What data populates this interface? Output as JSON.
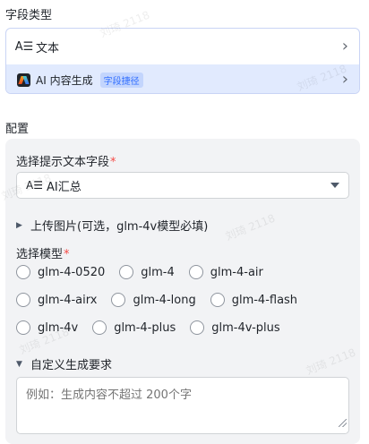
{
  "field_type": {
    "title": "字段类型",
    "text_option": {
      "icon": "text-type-icon",
      "icon_glyph": "A☰",
      "label": "文本"
    },
    "ai_option": {
      "icon": "ai-logo-icon",
      "label": "AI 内容生成",
      "badge": "字段捷径"
    }
  },
  "config": {
    "title": "配置",
    "prompt_field": {
      "label": "选择提示文本字段",
      "required_mark": "*",
      "icon_glyph": "A☰",
      "value": "AI汇总"
    },
    "upload": {
      "label": "上传图片(可选，glm-4v模型必填)"
    },
    "model": {
      "label": "选择模型",
      "required_mark": "*",
      "options_row1": [
        "glm-4-0520",
        "glm-4",
        "glm-4-air"
      ],
      "options_row2": [
        "glm-4-airx",
        "glm-4-long",
        "glm-4-flash"
      ],
      "options_row3": [
        "glm-4v",
        "glm-4-plus",
        "glm-4v-plus"
      ]
    },
    "custom": {
      "label": "自定义生成要求",
      "placeholder": "例如：生成内容不超过 200个字"
    }
  },
  "watermark_text": "刘琦 2118"
}
